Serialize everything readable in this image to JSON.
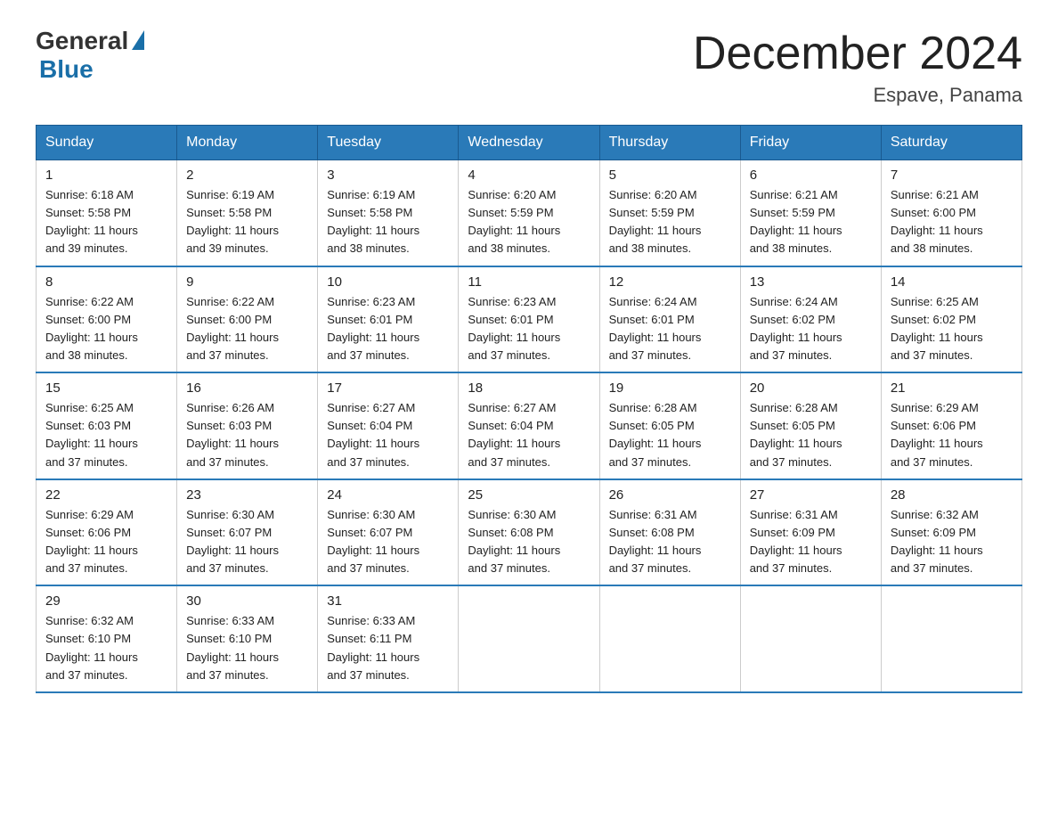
{
  "logo": {
    "general": "General",
    "blue": "Blue"
  },
  "title": "December 2024",
  "location": "Espave, Panama",
  "days_of_week": [
    "Sunday",
    "Monday",
    "Tuesday",
    "Wednesday",
    "Thursday",
    "Friday",
    "Saturday"
  ],
  "weeks": [
    [
      {
        "day": "1",
        "sunrise": "6:18 AM",
        "sunset": "5:58 PM",
        "daylight": "11 hours and 39 minutes."
      },
      {
        "day": "2",
        "sunrise": "6:19 AM",
        "sunset": "5:58 PM",
        "daylight": "11 hours and 39 minutes."
      },
      {
        "day": "3",
        "sunrise": "6:19 AM",
        "sunset": "5:58 PM",
        "daylight": "11 hours and 38 minutes."
      },
      {
        "day": "4",
        "sunrise": "6:20 AM",
        "sunset": "5:59 PM",
        "daylight": "11 hours and 38 minutes."
      },
      {
        "day": "5",
        "sunrise": "6:20 AM",
        "sunset": "5:59 PM",
        "daylight": "11 hours and 38 minutes."
      },
      {
        "day": "6",
        "sunrise": "6:21 AM",
        "sunset": "5:59 PM",
        "daylight": "11 hours and 38 minutes."
      },
      {
        "day": "7",
        "sunrise": "6:21 AM",
        "sunset": "6:00 PM",
        "daylight": "11 hours and 38 minutes."
      }
    ],
    [
      {
        "day": "8",
        "sunrise": "6:22 AM",
        "sunset": "6:00 PM",
        "daylight": "11 hours and 38 minutes."
      },
      {
        "day": "9",
        "sunrise": "6:22 AM",
        "sunset": "6:00 PM",
        "daylight": "11 hours and 37 minutes."
      },
      {
        "day": "10",
        "sunrise": "6:23 AM",
        "sunset": "6:01 PM",
        "daylight": "11 hours and 37 minutes."
      },
      {
        "day": "11",
        "sunrise": "6:23 AM",
        "sunset": "6:01 PM",
        "daylight": "11 hours and 37 minutes."
      },
      {
        "day": "12",
        "sunrise": "6:24 AM",
        "sunset": "6:01 PM",
        "daylight": "11 hours and 37 minutes."
      },
      {
        "day": "13",
        "sunrise": "6:24 AM",
        "sunset": "6:02 PM",
        "daylight": "11 hours and 37 minutes."
      },
      {
        "day": "14",
        "sunrise": "6:25 AM",
        "sunset": "6:02 PM",
        "daylight": "11 hours and 37 minutes."
      }
    ],
    [
      {
        "day": "15",
        "sunrise": "6:25 AM",
        "sunset": "6:03 PM",
        "daylight": "11 hours and 37 minutes."
      },
      {
        "day": "16",
        "sunrise": "6:26 AM",
        "sunset": "6:03 PM",
        "daylight": "11 hours and 37 minutes."
      },
      {
        "day": "17",
        "sunrise": "6:27 AM",
        "sunset": "6:04 PM",
        "daylight": "11 hours and 37 minutes."
      },
      {
        "day": "18",
        "sunrise": "6:27 AM",
        "sunset": "6:04 PM",
        "daylight": "11 hours and 37 minutes."
      },
      {
        "day": "19",
        "sunrise": "6:28 AM",
        "sunset": "6:05 PM",
        "daylight": "11 hours and 37 minutes."
      },
      {
        "day": "20",
        "sunrise": "6:28 AM",
        "sunset": "6:05 PM",
        "daylight": "11 hours and 37 minutes."
      },
      {
        "day": "21",
        "sunrise": "6:29 AM",
        "sunset": "6:06 PM",
        "daylight": "11 hours and 37 minutes."
      }
    ],
    [
      {
        "day": "22",
        "sunrise": "6:29 AM",
        "sunset": "6:06 PM",
        "daylight": "11 hours and 37 minutes."
      },
      {
        "day": "23",
        "sunrise": "6:30 AM",
        "sunset": "6:07 PM",
        "daylight": "11 hours and 37 minutes."
      },
      {
        "day": "24",
        "sunrise": "6:30 AM",
        "sunset": "6:07 PM",
        "daylight": "11 hours and 37 minutes."
      },
      {
        "day": "25",
        "sunrise": "6:30 AM",
        "sunset": "6:08 PM",
        "daylight": "11 hours and 37 minutes."
      },
      {
        "day": "26",
        "sunrise": "6:31 AM",
        "sunset": "6:08 PM",
        "daylight": "11 hours and 37 minutes."
      },
      {
        "day": "27",
        "sunrise": "6:31 AM",
        "sunset": "6:09 PM",
        "daylight": "11 hours and 37 minutes."
      },
      {
        "day": "28",
        "sunrise": "6:32 AM",
        "sunset": "6:09 PM",
        "daylight": "11 hours and 37 minutes."
      }
    ],
    [
      {
        "day": "29",
        "sunrise": "6:32 AM",
        "sunset": "6:10 PM",
        "daylight": "11 hours and 37 minutes."
      },
      {
        "day": "30",
        "sunrise": "6:33 AM",
        "sunset": "6:10 PM",
        "daylight": "11 hours and 37 minutes."
      },
      {
        "day": "31",
        "sunrise": "6:33 AM",
        "sunset": "6:11 PM",
        "daylight": "11 hours and 37 minutes."
      },
      null,
      null,
      null,
      null
    ]
  ],
  "labels": {
    "sunrise": "Sunrise: ",
    "sunset": "Sunset: ",
    "daylight": "Daylight: "
  }
}
